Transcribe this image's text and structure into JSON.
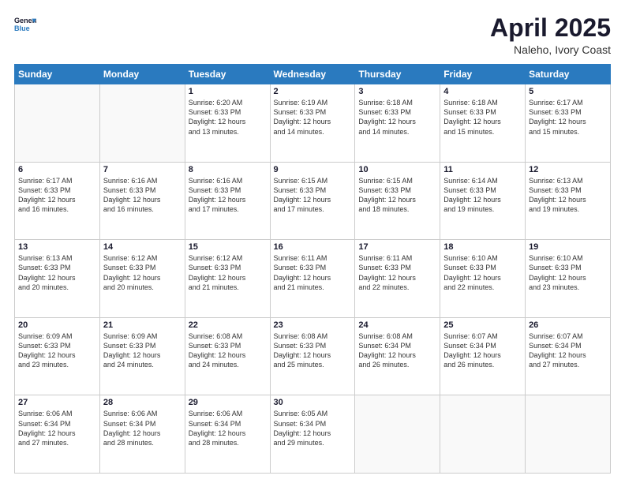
{
  "logo": {
    "line1": "General",
    "line2": "Blue"
  },
  "title": "April 2025",
  "subtitle": "Naleho, Ivory Coast",
  "days_of_week": [
    "Sunday",
    "Monday",
    "Tuesday",
    "Wednesday",
    "Thursday",
    "Friday",
    "Saturday"
  ],
  "weeks": [
    [
      {
        "num": "",
        "info": ""
      },
      {
        "num": "",
        "info": ""
      },
      {
        "num": "1",
        "info": "Sunrise: 6:20 AM\nSunset: 6:33 PM\nDaylight: 12 hours\nand 13 minutes."
      },
      {
        "num": "2",
        "info": "Sunrise: 6:19 AM\nSunset: 6:33 PM\nDaylight: 12 hours\nand 14 minutes."
      },
      {
        "num": "3",
        "info": "Sunrise: 6:18 AM\nSunset: 6:33 PM\nDaylight: 12 hours\nand 14 minutes."
      },
      {
        "num": "4",
        "info": "Sunrise: 6:18 AM\nSunset: 6:33 PM\nDaylight: 12 hours\nand 15 minutes."
      },
      {
        "num": "5",
        "info": "Sunrise: 6:17 AM\nSunset: 6:33 PM\nDaylight: 12 hours\nand 15 minutes."
      }
    ],
    [
      {
        "num": "6",
        "info": "Sunrise: 6:17 AM\nSunset: 6:33 PM\nDaylight: 12 hours\nand 16 minutes."
      },
      {
        "num": "7",
        "info": "Sunrise: 6:16 AM\nSunset: 6:33 PM\nDaylight: 12 hours\nand 16 minutes."
      },
      {
        "num": "8",
        "info": "Sunrise: 6:16 AM\nSunset: 6:33 PM\nDaylight: 12 hours\nand 17 minutes."
      },
      {
        "num": "9",
        "info": "Sunrise: 6:15 AM\nSunset: 6:33 PM\nDaylight: 12 hours\nand 17 minutes."
      },
      {
        "num": "10",
        "info": "Sunrise: 6:15 AM\nSunset: 6:33 PM\nDaylight: 12 hours\nand 18 minutes."
      },
      {
        "num": "11",
        "info": "Sunrise: 6:14 AM\nSunset: 6:33 PM\nDaylight: 12 hours\nand 19 minutes."
      },
      {
        "num": "12",
        "info": "Sunrise: 6:13 AM\nSunset: 6:33 PM\nDaylight: 12 hours\nand 19 minutes."
      }
    ],
    [
      {
        "num": "13",
        "info": "Sunrise: 6:13 AM\nSunset: 6:33 PM\nDaylight: 12 hours\nand 20 minutes."
      },
      {
        "num": "14",
        "info": "Sunrise: 6:12 AM\nSunset: 6:33 PM\nDaylight: 12 hours\nand 20 minutes."
      },
      {
        "num": "15",
        "info": "Sunrise: 6:12 AM\nSunset: 6:33 PM\nDaylight: 12 hours\nand 21 minutes."
      },
      {
        "num": "16",
        "info": "Sunrise: 6:11 AM\nSunset: 6:33 PM\nDaylight: 12 hours\nand 21 minutes."
      },
      {
        "num": "17",
        "info": "Sunrise: 6:11 AM\nSunset: 6:33 PM\nDaylight: 12 hours\nand 22 minutes."
      },
      {
        "num": "18",
        "info": "Sunrise: 6:10 AM\nSunset: 6:33 PM\nDaylight: 12 hours\nand 22 minutes."
      },
      {
        "num": "19",
        "info": "Sunrise: 6:10 AM\nSunset: 6:33 PM\nDaylight: 12 hours\nand 23 minutes."
      }
    ],
    [
      {
        "num": "20",
        "info": "Sunrise: 6:09 AM\nSunset: 6:33 PM\nDaylight: 12 hours\nand 23 minutes."
      },
      {
        "num": "21",
        "info": "Sunrise: 6:09 AM\nSunset: 6:33 PM\nDaylight: 12 hours\nand 24 minutes."
      },
      {
        "num": "22",
        "info": "Sunrise: 6:08 AM\nSunset: 6:33 PM\nDaylight: 12 hours\nand 24 minutes."
      },
      {
        "num": "23",
        "info": "Sunrise: 6:08 AM\nSunset: 6:33 PM\nDaylight: 12 hours\nand 25 minutes."
      },
      {
        "num": "24",
        "info": "Sunrise: 6:08 AM\nSunset: 6:34 PM\nDaylight: 12 hours\nand 26 minutes."
      },
      {
        "num": "25",
        "info": "Sunrise: 6:07 AM\nSunset: 6:34 PM\nDaylight: 12 hours\nand 26 minutes."
      },
      {
        "num": "26",
        "info": "Sunrise: 6:07 AM\nSunset: 6:34 PM\nDaylight: 12 hours\nand 27 minutes."
      }
    ],
    [
      {
        "num": "27",
        "info": "Sunrise: 6:06 AM\nSunset: 6:34 PM\nDaylight: 12 hours\nand 27 minutes."
      },
      {
        "num": "28",
        "info": "Sunrise: 6:06 AM\nSunset: 6:34 PM\nDaylight: 12 hours\nand 28 minutes."
      },
      {
        "num": "29",
        "info": "Sunrise: 6:06 AM\nSunset: 6:34 PM\nDaylight: 12 hours\nand 28 minutes."
      },
      {
        "num": "30",
        "info": "Sunrise: 6:05 AM\nSunset: 6:34 PM\nDaylight: 12 hours\nand 29 minutes."
      },
      {
        "num": "",
        "info": ""
      },
      {
        "num": "",
        "info": ""
      },
      {
        "num": "",
        "info": ""
      }
    ]
  ]
}
